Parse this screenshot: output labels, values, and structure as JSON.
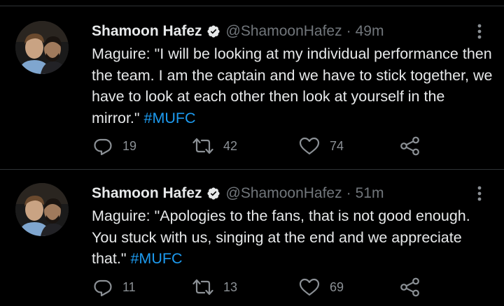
{
  "tweets": [
    {
      "author": "Shamoon Hafez",
      "handle": "@ShamoonHafez",
      "separator": "·",
      "time": "49m",
      "text": "Maguire: \"I will be looking at my individual performance then the team. I am the captain and we have to stick together, we have to look at each other then look at yourself in the mirror.\" ",
      "hashtag": "#MUFC",
      "replies": "19",
      "retweets": "42",
      "likes": "74"
    },
    {
      "author": "Shamoon Hafez",
      "handle": "@ShamoonHafez",
      "separator": "·",
      "time": "51m",
      "text": "Maguire: \"Apologies to the fans, that is not good enough. You stuck with us, singing at the end and we appreciate that.\" ",
      "hashtag": "#MUFC",
      "replies": "11",
      "retweets": "13",
      "likes": "69"
    }
  ],
  "icons": {
    "verified": "verified-badge-icon",
    "more": "more-vertical-icon",
    "reply": "reply-icon",
    "retweet": "retweet-icon",
    "like": "heart-icon",
    "share": "share-icon"
  },
  "colors": {
    "background": "#000000",
    "text": "#e7e9ea",
    "muted": "#71767b",
    "accent": "#1d9bf0",
    "divider": "#2f3336"
  }
}
